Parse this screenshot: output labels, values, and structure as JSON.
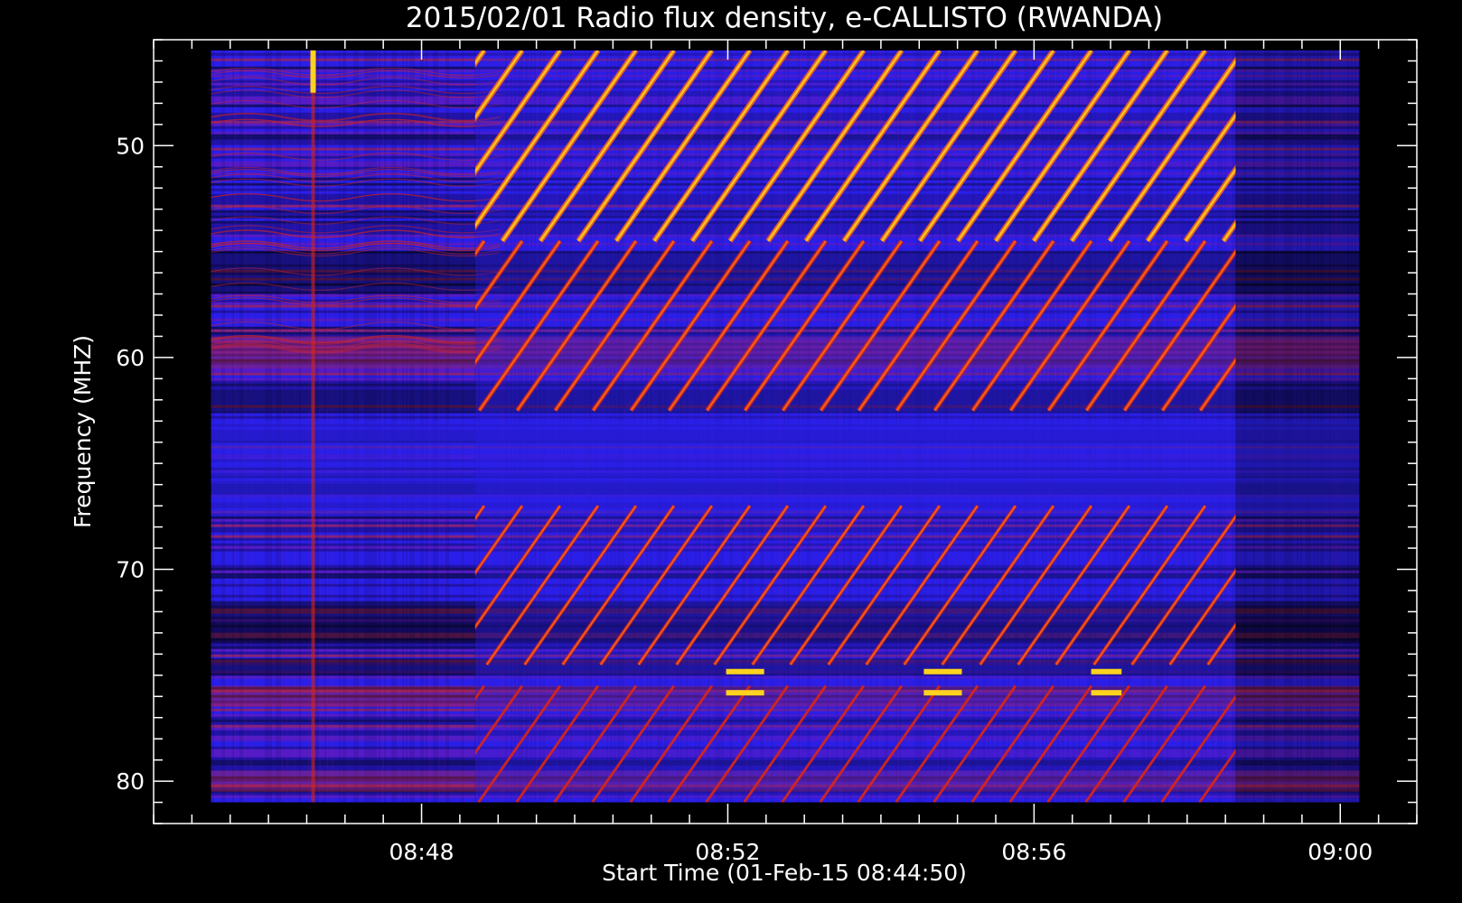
{
  "chart_data": {
    "type": "heatmap",
    "title": "2015/02/01  Radio flux density, e-CALLISTO (RWANDA)",
    "xlabel": "Start Time (01-Feb-15 08:44:50)",
    "ylabel": "Frequency (MHZ)",
    "x_unit": "time (HH:MM)",
    "y_unit": "MHz",
    "x_range": [
      "08:44:30",
      "09:01:00"
    ],
    "data_time_range": [
      "08:45:15",
      "09:00:15"
    ],
    "y_range": [
      45,
      82
    ],
    "y_inverted": true,
    "x_ticks": [
      "08:48",
      "08:52",
      "08:56",
      "09:00"
    ],
    "y_ticks": [
      50,
      60,
      70,
      80
    ],
    "colormap": [
      "#000000",
      "#1a0a6e",
      "#2a1fe8",
      "#7a18a8",
      "#d4261c",
      "#ff6a10",
      "#ffd21e",
      "#fff47a"
    ],
    "segments": [
      {
        "start": "08:45:15",
        "end": "08:48:42",
        "level": "moderate"
      },
      {
        "start": "08:48:42",
        "end": "08:58:38",
        "level": "high",
        "pattern": "diagonal stripes"
      },
      {
        "start": "08:58:38",
        "end": "09:00:15",
        "level": "low"
      }
    ],
    "features": [
      {
        "type": "vertical burst",
        "time": "08:46:35",
        "freq_range": [
          45,
          81
        ]
      }
    ],
    "grid": false,
    "legend": "none"
  }
}
